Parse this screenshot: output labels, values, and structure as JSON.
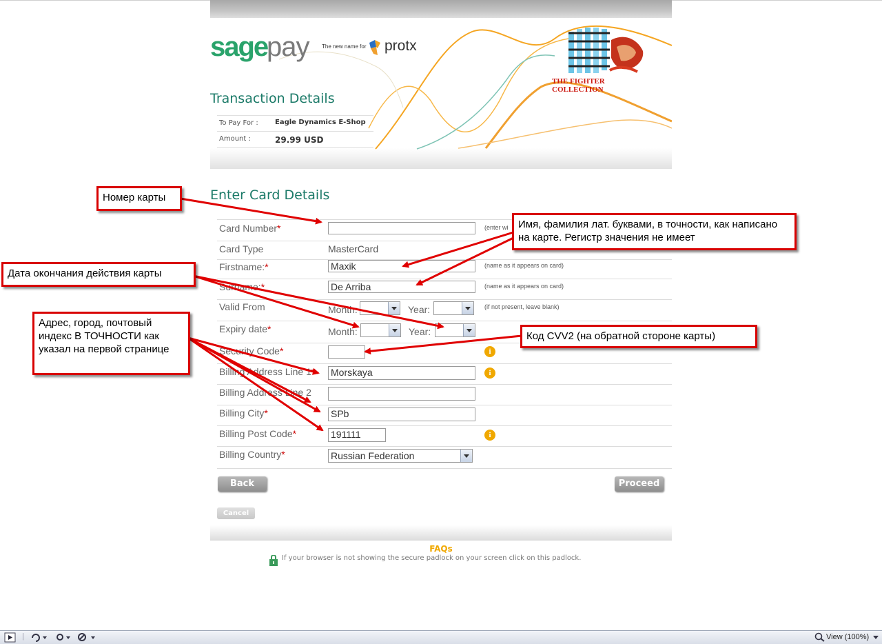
{
  "header": {
    "brand_sage": "sage",
    "brand_pay": "pay",
    "new_name_for": "The new name for",
    "protx": "protx",
    "merchant_name": "THE FIGHTER COLLECTION"
  },
  "transaction": {
    "title": "Transaction Details",
    "to_pay_for_label": "To Pay For :",
    "to_pay_for_value": "Eagle Dynamics E-Shop",
    "amount_label": "Amount :",
    "amount_value": "29.99 USD"
  },
  "card_form": {
    "title": "Enter Card Details",
    "card_number_label": "Card Number",
    "card_number_hint": "(enter wi",
    "card_number_value": "",
    "card_type_label": "Card Type",
    "card_type_value": "MasterCard",
    "firstname_label": "Firstname:",
    "firstname_value": "Maxik",
    "firstname_hint": "(name as it appears on card)",
    "surname_label": "Surname:",
    "surname_value": "De Arriba",
    "surname_hint": "(name as it appears on card)",
    "valid_from_label": "Valid From",
    "valid_from_hint": "(if not present, leave blank)",
    "month_label": "Month:",
    "year_label": "Year:",
    "expiry_label": "Expiry date",
    "security_label": "Security Code",
    "security_value": "",
    "billing1_label": "Billing Address Line 1",
    "billing1_value": "Morskaya",
    "billing2_label": "Billing Address Line 2",
    "billing2_value": "",
    "city_label": "Billing City",
    "city_value": "SPb",
    "post_label": "Billing Post Code",
    "post_value": "191111",
    "country_label": "Billing Country",
    "country_value": "Russian Federation",
    "required_mark": "*",
    "info_glyph": "i"
  },
  "buttons": {
    "back": "Back",
    "proceed": "Proceed",
    "cancel": "Cancel"
  },
  "footer": {
    "faqs": "FAQs",
    "padlock_text": "If your browser is not showing the secure padlock on your screen click on this padlock."
  },
  "annotations": {
    "card_number": "Номер карты",
    "name": "Имя, фамилия лат. буквами, в точности, как написано на карте. Регистр значения не имеет",
    "expiry": "Дата окончания действия карты",
    "cvv": "Код CVV2 (на обратной стороне карты)",
    "address": "Адрес, город, почтовый индекс В ТОЧНОСТИ как указал на первой странице"
  },
  "statusbar": {
    "zoom": "View (100%)"
  },
  "colors": {
    "brand_green": "#2aa36b",
    "title_teal": "#1b7a68",
    "annotation_red": "#d80000",
    "info_orange": "#f0a800",
    "merchant_red": "#cc1a12"
  }
}
